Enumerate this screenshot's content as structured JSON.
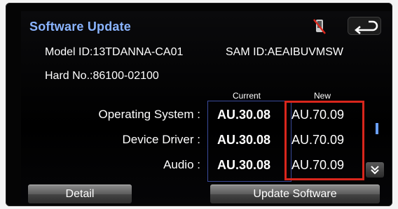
{
  "header": {
    "title": "Software Update"
  },
  "info": {
    "model_id": "Model ID:13TDANNA-CA01",
    "sam_id": "SAM ID:AEAIBUVMSW",
    "hard_no": "Hard No.:86100-02100"
  },
  "table": {
    "headers": {
      "current": "Current",
      "new": "New"
    },
    "rows": [
      {
        "label": "Operating System :",
        "current": "AU.30.08",
        "new": "AU.70.09"
      },
      {
        "label": "Device Driver :",
        "current": "AU.30.08",
        "new": "AU.70.09"
      },
      {
        "label": "Audio :",
        "current": "AU.30.08",
        "new": "AU.70.09"
      }
    ]
  },
  "buttons": {
    "detail": "Detail",
    "update": "Update Software"
  },
  "icons": {
    "phone": "phone-muted-icon",
    "back": "back-arrow-icon",
    "scroll_down": "chevron-down-icon"
  },
  "colors": {
    "title": "#8ab4ff",
    "highlight": "#d9261c",
    "current_border": "#3a4a9a"
  }
}
